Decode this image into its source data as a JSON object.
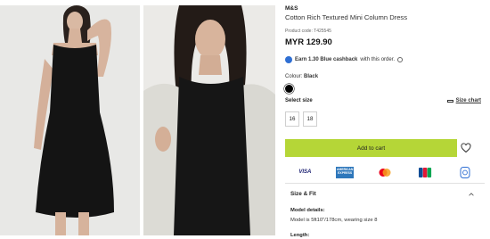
{
  "product": {
    "brand": "M&S",
    "title": "Cotton Rich Textured Mini Column Dress",
    "code": "Product code: T425545",
    "price": "MYR 129.90"
  },
  "cashback": {
    "prefix": "Earn 1.30 Blue cashback",
    "suffix": "with this order."
  },
  "colour": {
    "label": "Colour:",
    "value": "Black",
    "swatch_color": "#000000"
  },
  "size": {
    "label": "Select size",
    "chart_link": "Size chart",
    "options": [
      "16",
      "18"
    ]
  },
  "cart": {
    "button_label": "Add to cart",
    "button_color": "#b5d637"
  },
  "payments": {
    "visa": "VISA",
    "amex": "AMERICAN EXPRESS"
  },
  "size_fit": {
    "heading": "Size & Fit",
    "model_label": "Model details:",
    "model_value": "Model is 5ft10\"/178cm, wearing size 8",
    "length_label": "Length:"
  },
  "icons": [
    "cashback-icon",
    "info-icon",
    "ruler-icon",
    "heart-icon",
    "chevron-up-icon",
    "mastercard-icon",
    "jcb-icon",
    "fpx-icon"
  ]
}
